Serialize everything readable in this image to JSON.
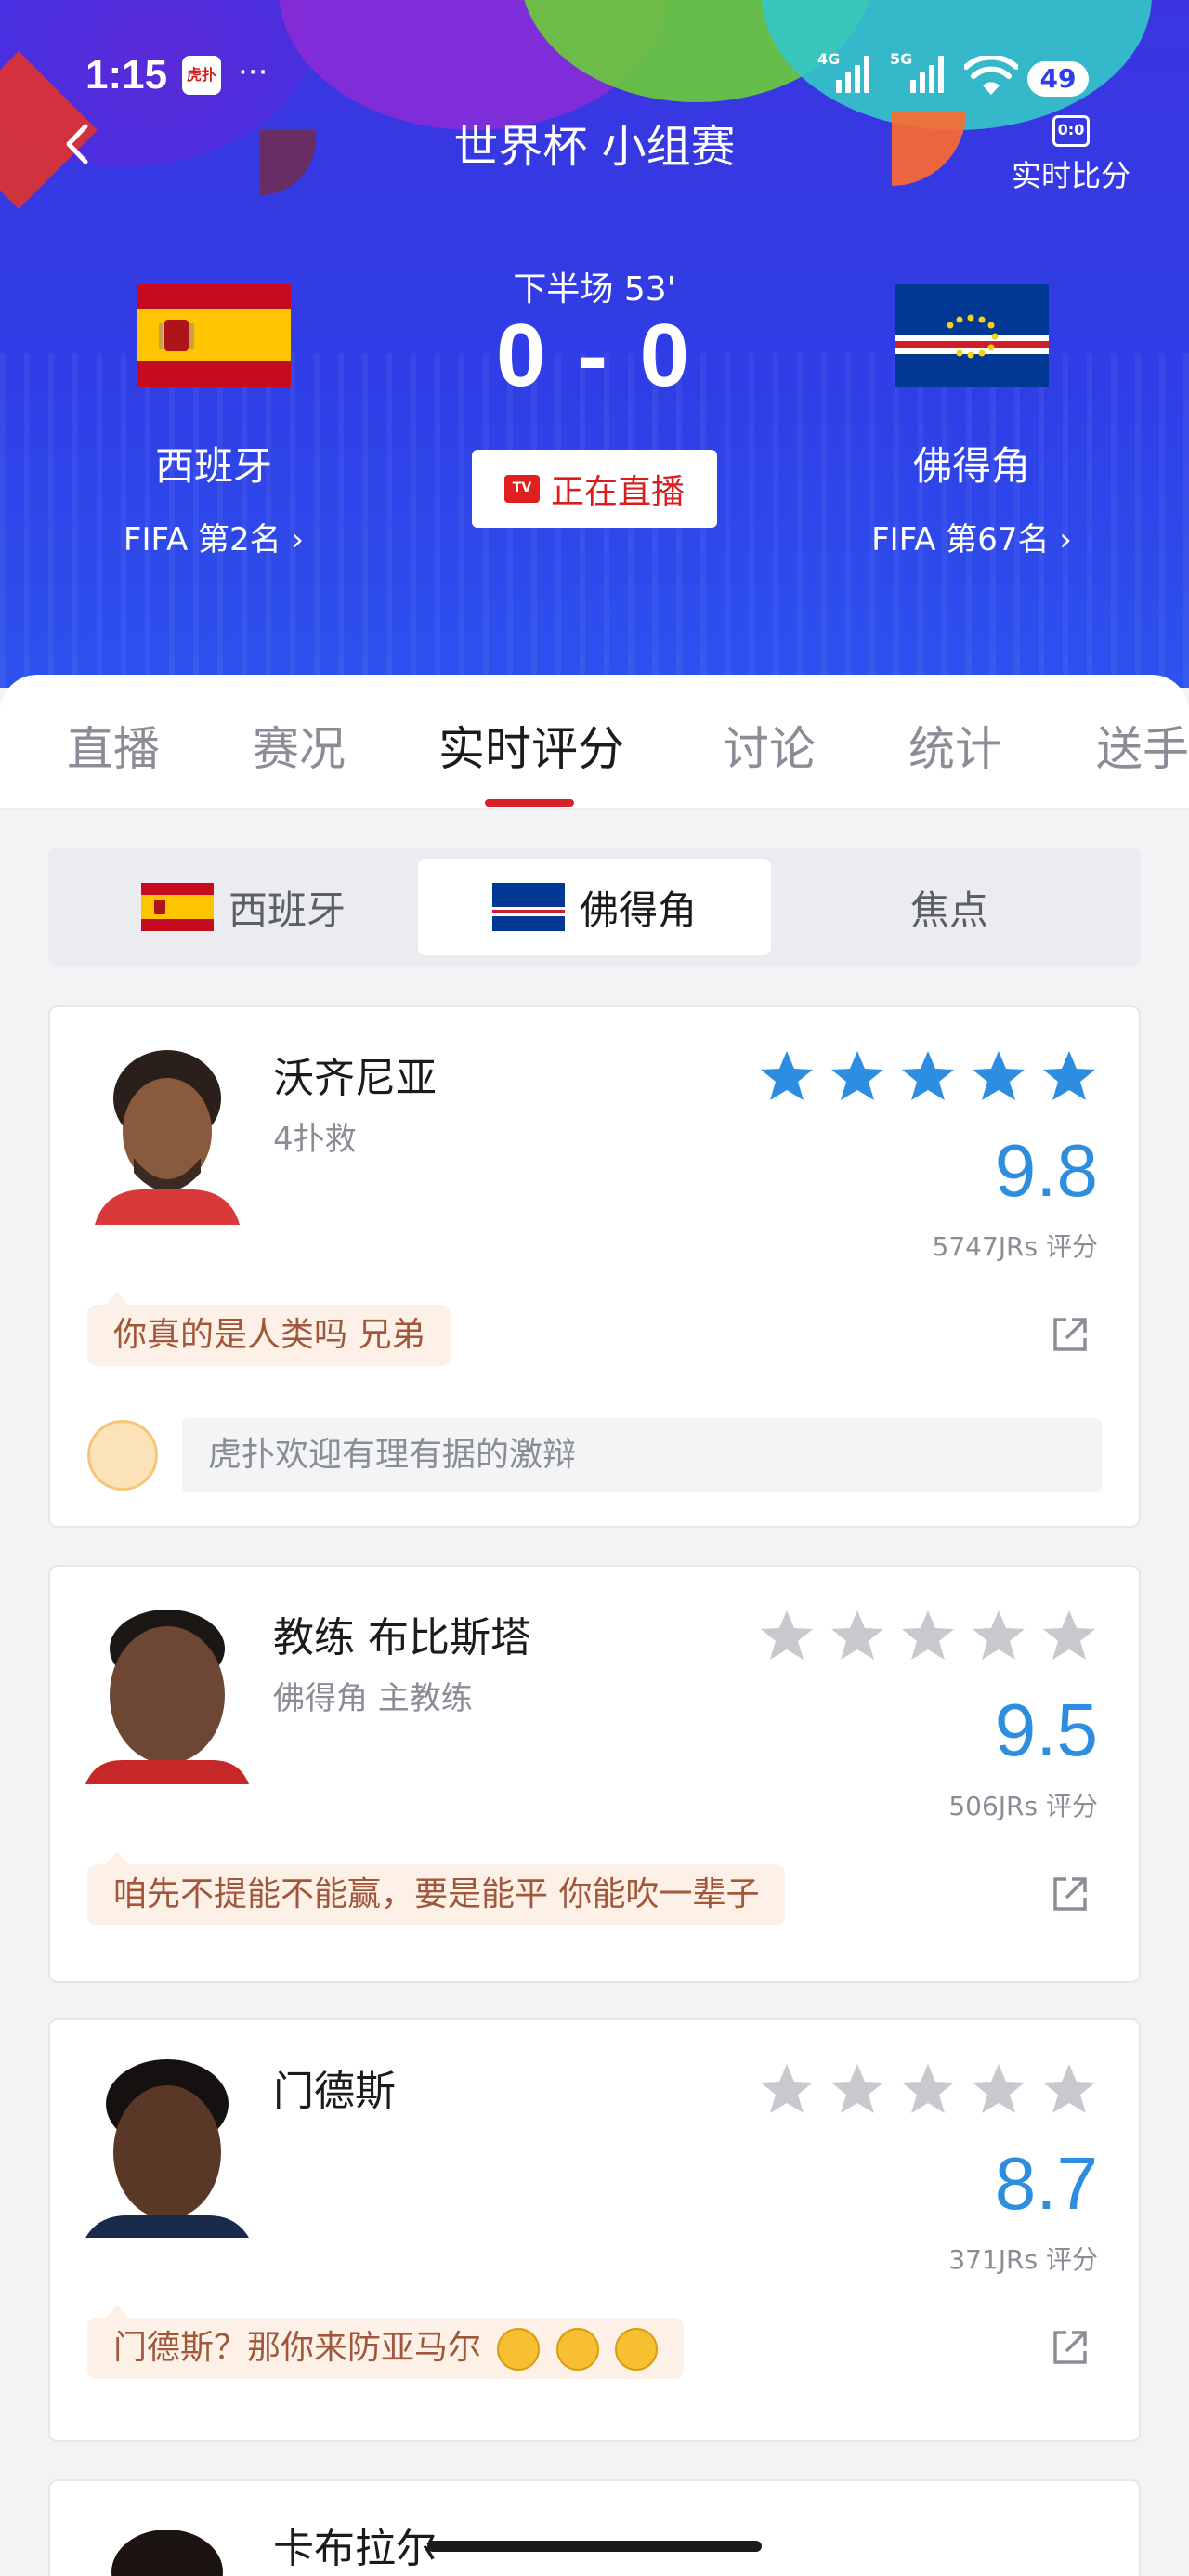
{
  "status_bar": {
    "time": "1:15",
    "app_badge": "虎扑",
    "more": "···",
    "net1": "4G",
    "net2": "5G",
    "battery": "49"
  },
  "header": {
    "title": "世界杯 小组赛",
    "live_score_label": "实时比分",
    "live_score_icon_text": "0:0",
    "period": "下半场 53'",
    "score": "0 - 0",
    "live_button": "正在直播",
    "live_icon_text": "TV",
    "home": {
      "name": "西班牙",
      "rank": "FIFA 第2名"
    },
    "away": {
      "name": "佛得角",
      "rank": "FIFA 第67名"
    }
  },
  "tabs": [
    {
      "label": "直播"
    },
    {
      "label": "赛况"
    },
    {
      "label": "实时评分"
    },
    {
      "label": "讨论"
    },
    {
      "label": "统计"
    },
    {
      "label": "送手"
    }
  ],
  "segment": {
    "home": "西班牙",
    "away": "佛得角",
    "focus": "焦点"
  },
  "players": [
    {
      "name": "沃齐尼亚",
      "desc": "4扑救",
      "stars": 5,
      "rating": "9.8",
      "votes": "5747JRs 评分",
      "comment": "你真的是人类吗 兄弟",
      "reply_placeholder": "虎扑欢迎有理有据的激辩"
    },
    {
      "name": "教练 布比斯塔",
      "desc": "佛得角 主教练",
      "stars": 0,
      "rating": "9.5",
      "votes": "506JRs 评分",
      "comment": "咱先不提能不能赢，要是能平 你能吹一辈子"
    },
    {
      "name": "门德斯",
      "desc": "",
      "stars": 0,
      "rating": "8.7",
      "votes": "371JRs 评分",
      "comment": "门德斯？那你来防亚马尔"
    },
    {
      "name": "卡布拉尔"
    }
  ],
  "colors": {
    "header_blue": "#2f3ee6",
    "accent_red": "#d6202a",
    "rating_blue": "#2d8de0",
    "star_blue": "#2d8de0",
    "star_grey": "#c8c9cf"
  }
}
